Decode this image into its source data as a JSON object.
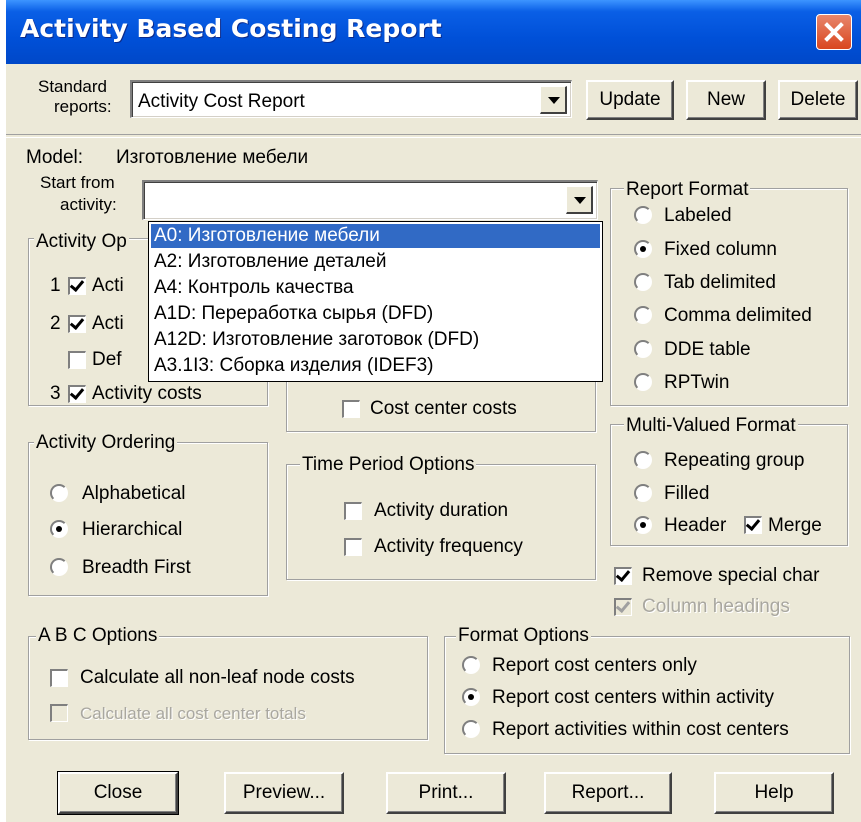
{
  "window": {
    "title": "Activity Based Costing Report"
  },
  "top": {
    "standard_label_1": "Standard",
    "standard_label_2": "reports:",
    "standard_value": "Activity Cost Report",
    "update": "Update",
    "new": "New",
    "delete": "Delete"
  },
  "model": {
    "label": "Model:",
    "value": "Изготовление мебели"
  },
  "start": {
    "label_1": "Start from",
    "label_2": "activity:",
    "value": ""
  },
  "dropdown_options": [
    "A0:  Изготовление мебели",
    "A2:  Изготовление деталей",
    "A4:  Контроль качества",
    "A1D:  Переработка сырья (DFD)",
    "A12D:  Изготовление заготовок (DFD)",
    "A3.1I3:  Сборка изделия (IDEF3)"
  ],
  "activity_options": {
    "title_partial": "Activity Op",
    "n1": "1",
    "n2": "2",
    "n3": "3",
    "item1_partial": "Acti",
    "item2_partial": "Acti",
    "item3_partial": "Def",
    "item4": "Activity costs"
  },
  "cost_center_costs": "Cost center costs",
  "report_format": {
    "title": "Report Format",
    "options": [
      "Labeled",
      "Fixed column",
      "Tab delimited",
      "Comma delimited",
      "DDE table",
      "RPTwin"
    ],
    "selected": "Fixed column"
  },
  "multi_valued": {
    "title": "Multi-Valued Format",
    "options": [
      "Repeating group",
      "Filled",
      "Header"
    ],
    "selected": "Header",
    "merge": "Merge"
  },
  "remove_special": "Remove special char",
  "column_headings": "Column headings",
  "activity_ordering": {
    "title": "Activity Ordering",
    "options": [
      "Alphabetical",
      "Hierarchical",
      "Breadth First"
    ],
    "selected": "Hierarchical"
  },
  "time_period": {
    "title": "Time Period Options",
    "duration": "Activity duration",
    "frequency": "Activity frequency"
  },
  "abc_options": {
    "title": "A B C  Options",
    "calc_nonleaf": "Calculate all non-leaf node costs",
    "calc_totals": "Calculate all cost center totals"
  },
  "format_options": {
    "title": "Format Options",
    "options": [
      "Report cost centers only",
      "Report cost centers within activity",
      "Report activities within cost centers"
    ],
    "selected": "Report cost centers within activity"
  },
  "buttons": {
    "close": "Close",
    "preview": "Preview...",
    "print": "Print...",
    "report": "Report...",
    "help": "Help"
  }
}
